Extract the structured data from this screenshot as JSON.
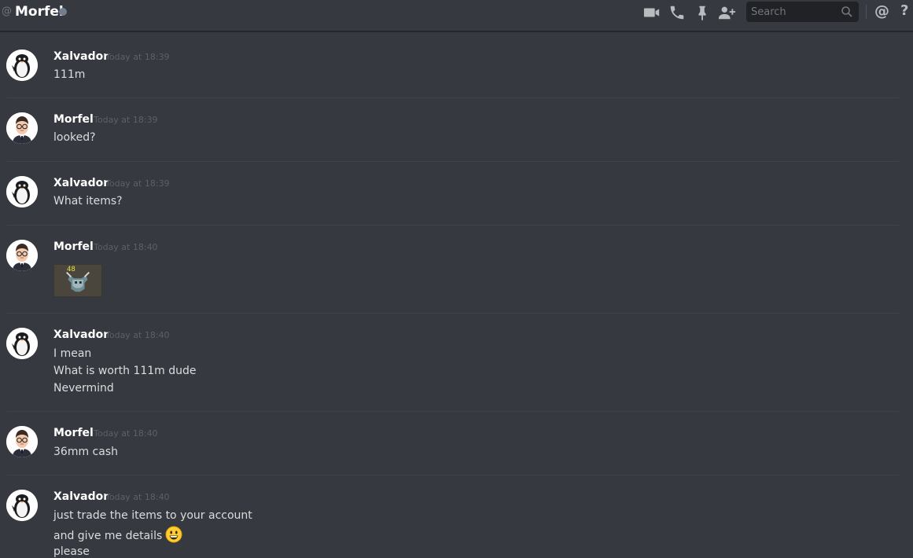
{
  "header": {
    "at_symbol": "@",
    "channel_name": "Morfel",
    "status": "offline",
    "status_color": "#747f8d",
    "icons": [
      "video-call-icon",
      "voice-call-icon",
      "pin-icon",
      "add-friend-icon"
    ],
    "search": {
      "placeholder": "Search"
    },
    "mention_icon": "@",
    "help_icon": "?"
  },
  "messages": [
    {
      "author": "Xalvador",
      "avatar": "penguin-avatar",
      "timestamp": "Today at 18:39",
      "lines": [
        "111m"
      ]
    },
    {
      "author": "Morfel",
      "avatar": "man-with-glasses-avatar",
      "timestamp": "Today at 18:39",
      "lines": [
        "looked?"
      ]
    },
    {
      "author": "Xalvador",
      "avatar": "penguin-avatar",
      "timestamp": "Today at 18:39",
      "lines": [
        "What items?"
      ]
    },
    {
      "author": "Morfel",
      "avatar": "man-with-glasses-avatar",
      "timestamp": "Today at 18:40",
      "lines": [],
      "attachment": {
        "type": "image",
        "label": "48"
      }
    },
    {
      "author": "Xalvador",
      "avatar": "penguin-avatar",
      "timestamp": "Today at 18:40",
      "lines": [
        "I mean",
        "What is worth 111m dude",
        "Nevermind"
      ]
    },
    {
      "author": "Morfel",
      "avatar": "man-with-glasses-avatar",
      "timestamp": "Today at 18:40",
      "lines": [
        "36mm cash"
      ]
    },
    {
      "author": "Xalvador",
      "avatar": "penguin-avatar",
      "timestamp": "Today at 18:40",
      "lines": [
        "just trade the items to your account",
        "and give me details",
        "please"
      ],
      "emoji": "smiley-emoji"
    }
  ],
  "colors": {
    "background": "#36393f",
    "username": "#ffffff",
    "timestamp": "#5c6067",
    "text": "#dcddde",
    "separator": "#40444b"
  }
}
